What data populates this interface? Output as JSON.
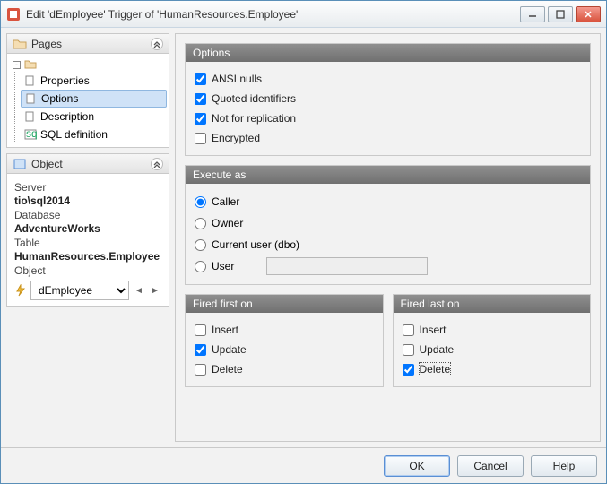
{
  "window": {
    "title": "Edit 'dEmployee' Trigger of 'HumanResources.Employee'"
  },
  "pages_panel": {
    "title": "Pages",
    "root_icon": "folder-icon",
    "items": [
      {
        "label": "Properties",
        "selected": false
      },
      {
        "label": "Options",
        "selected": true
      },
      {
        "label": "Description",
        "selected": false
      },
      {
        "label": "SQL definition",
        "selected": false
      }
    ]
  },
  "object_panel": {
    "title": "Object",
    "server_label": "Server",
    "server_value": "tio\\sql2014",
    "database_label": "Database",
    "database_value": "AdventureWorks",
    "table_label": "Table",
    "table_value": "HumanResources.Employee",
    "object_label": "Object",
    "object_selected": "dEmployee"
  },
  "options_group": {
    "title": "Options",
    "items": [
      {
        "label": "ANSI nulls",
        "checked": true
      },
      {
        "label": "Quoted identifiers",
        "checked": true
      },
      {
        "label": "Not for replication",
        "checked": true
      },
      {
        "label": "Encrypted",
        "checked": false
      }
    ]
  },
  "execute_as_group": {
    "title": "Execute as",
    "options": [
      {
        "label": "Caller",
        "selected": true
      },
      {
        "label": "Owner",
        "selected": false
      },
      {
        "label": "Current user (dbo)",
        "selected": false
      },
      {
        "label": "User",
        "selected": false
      }
    ],
    "user_value": ""
  },
  "fired_first": {
    "title": "Fired first on",
    "items": [
      {
        "label": "Insert",
        "checked": false
      },
      {
        "label": "Update",
        "checked": true
      },
      {
        "label": "Delete",
        "checked": false
      }
    ]
  },
  "fired_last": {
    "title": "Fired last on",
    "items": [
      {
        "label": "Insert",
        "checked": false
      },
      {
        "label": "Update",
        "checked": false
      },
      {
        "label": "Delete",
        "checked": true,
        "focused": true
      }
    ]
  },
  "buttons": {
    "ok": "OK",
    "cancel": "Cancel",
    "help": "Help"
  }
}
